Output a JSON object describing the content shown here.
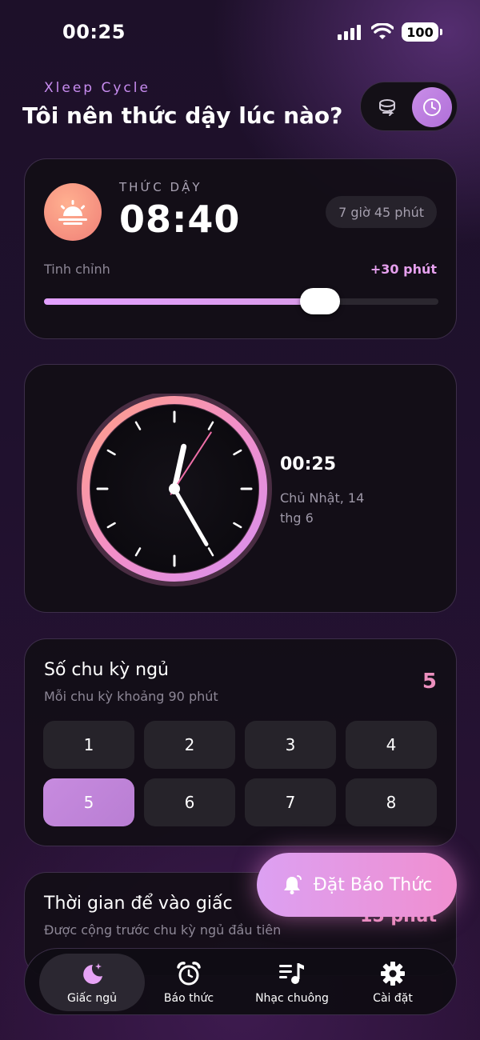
{
  "status_bar": {
    "time": "00:25",
    "battery": "100"
  },
  "header": {
    "brand": "Xleep Cycle",
    "title": "Tôi nên thức dậy lúc nào?"
  },
  "wake": {
    "label": "THỨC DẬY",
    "time": "08:40",
    "duration": "7 giờ 45 phút",
    "adjust_label": "Tinh chỉnh",
    "adjust_value": "+30 phút",
    "slider_fraction": 0.7
  },
  "clock": {
    "time": "00:25",
    "date": "Chủ Nhật, 14 thg 6"
  },
  "cycles": {
    "title": "Số chu kỳ ngủ",
    "subtitle": "Mỗi chu kỳ khoảng 90 phút",
    "value": "5",
    "options": [
      "1",
      "2",
      "3",
      "4",
      "5",
      "6",
      "7",
      "8"
    ],
    "selected": "5"
  },
  "fall_asleep": {
    "title": "Thời gian để vào giấc",
    "subtitle": "Được cộng trước chu kỳ ngủ đầu tiên",
    "value": "15 phút"
  },
  "fab": {
    "label": "Đặt Báo Thức",
    "icon": "bell-icon"
  },
  "tabs": [
    {
      "label": "Giấc ngủ",
      "icon": "moon-stars-icon"
    },
    {
      "label": "Báo thức",
      "icon": "alarm-clock-icon"
    },
    {
      "label": "Nhạc chuông",
      "icon": "music-list-icon"
    },
    {
      "label": "Cài đặt",
      "icon": "gear-icon"
    }
  ],
  "colors": {
    "accent": "#c98ee8",
    "pink": "#ec8fbe",
    "sun": "#f07f77"
  }
}
